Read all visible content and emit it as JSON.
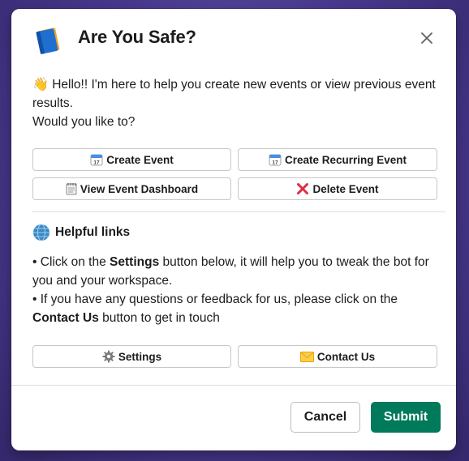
{
  "modal": {
    "title": "Are You Safe?",
    "app_icon": "notebook-icon",
    "close_icon": "close-icon"
  },
  "intro": {
    "wave_emoji": "👋",
    "line1": "Hello!! I'm here to help you create new events or view previous event results.",
    "line2": "Would you like to?"
  },
  "actions": [
    {
      "icon": "calendar-icon",
      "label": "Create Event"
    },
    {
      "icon": "calendar-icon",
      "label": "Create Recurring Event"
    },
    {
      "icon": "spiral-notepad-icon",
      "label": "View Event Dashboard"
    },
    {
      "icon": "red-x-icon",
      "label": "Delete Event"
    }
  ],
  "helpful": {
    "heading": "Helpful links",
    "icon": "globe-icon",
    "bullet": "•",
    "p1_pre": " Click on the ",
    "p1_bold": "Settings",
    "p1_post": " button below, it will help you to tweak the bot for you and your workspace.",
    "p2_pre": " If you have any questions or feedback for us, please click on the ",
    "p2_bold": "Contact Us",
    "p2_post": " button to get in touch"
  },
  "link_buttons": [
    {
      "icon": "gear-icon",
      "label": "Settings"
    },
    {
      "icon": "envelope-icon",
      "label": "Contact Us"
    }
  ],
  "footer": {
    "cancel_label": "Cancel",
    "submit_label": "Submit"
  },
  "colors": {
    "submit_bg": "#007a5a",
    "backdrop": "#4a3a90",
    "text": "#1d1c1d"
  }
}
